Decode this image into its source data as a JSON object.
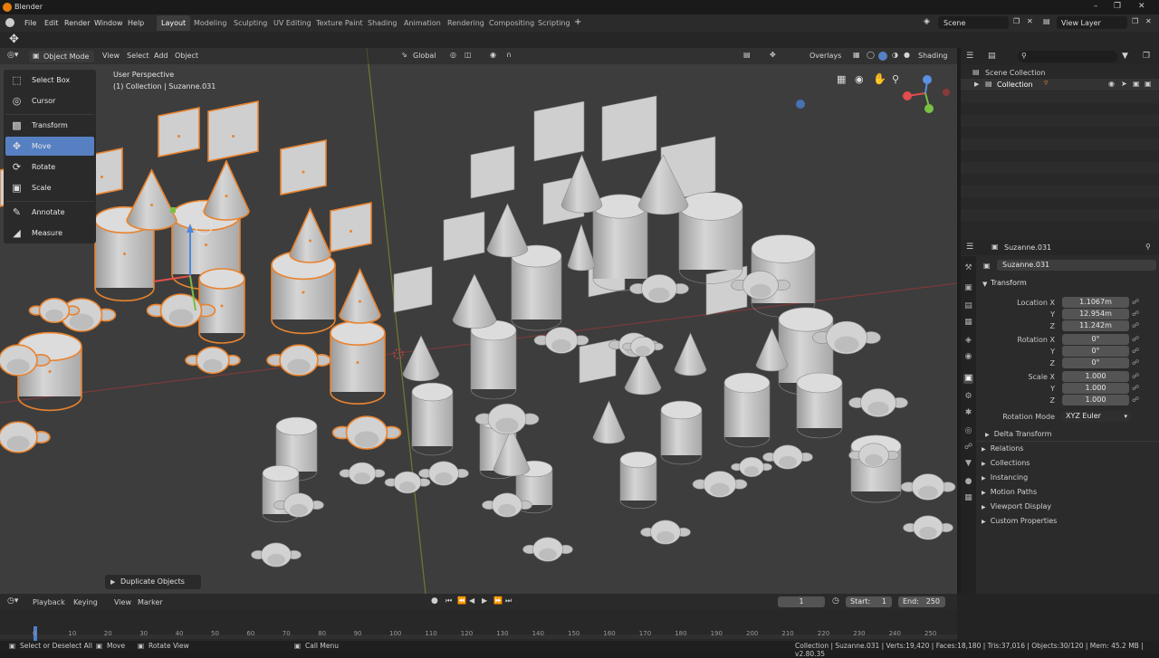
{
  "app": {
    "title": "Blender"
  },
  "menu": [
    "File",
    "Edit",
    "Render",
    "Window",
    "Help"
  ],
  "workspaces": [
    "Layout",
    "Modeling",
    "Sculpting",
    "UV Editing",
    "Texture Paint",
    "Shading",
    "Animation",
    "Rendering",
    "Compositing",
    "Scripting"
  ],
  "scene": {
    "name": "Scene",
    "view_layer": "View Layer"
  },
  "viewport_header": {
    "mode": "Object Mode",
    "menus": [
      "View",
      "Select",
      "Add",
      "Object"
    ],
    "orientation": "Global",
    "overlays": "Overlays",
    "shading": "Shading"
  },
  "viewport_info": {
    "line1": "User Perspective",
    "line2": "(1) Collection | Suzanne.031"
  },
  "toolbar": {
    "tools": [
      "Select Box",
      "Cursor",
      "Transform",
      "Move",
      "Rotate",
      "Scale",
      "Annotate",
      "Measure"
    ],
    "active": "Move"
  },
  "operator_panel": "Duplicate Objects",
  "outliner": {
    "root": "Scene Collection",
    "collection": "Collection"
  },
  "properties": {
    "object_name": "Suzanne.031",
    "object_field": "Suzanne.031",
    "transform_title": "Transform",
    "location": {
      "label": "Location X",
      "y_label": "Y",
      "z_label": "Z",
      "x": "1.1067m",
      "y": "12.954m",
      "z": "11.242m"
    },
    "rotation": {
      "label": "Rotation X",
      "y_label": "Y",
      "z_label": "Z",
      "x": "0°",
      "y": "0°",
      "z": "0°"
    },
    "scale": {
      "label": "Scale X",
      "y_label": "Y",
      "z_label": "Z",
      "x": "1.000",
      "y": "1.000",
      "z": "1.000"
    },
    "rotation_mode": {
      "label": "Rotation Mode",
      "value": "XYZ Euler"
    },
    "panels": [
      "Delta Transform",
      "Relations",
      "Collections",
      "Instancing",
      "Motion Paths",
      "Viewport Display",
      "Custom Properties"
    ]
  },
  "timeline": {
    "menus": [
      "Playback",
      "Keying",
      "View",
      "Marker"
    ],
    "current_frame": "1",
    "start_label": "Start:",
    "start": "1",
    "end_label": "End:",
    "end": "250",
    "ticks": [
      "0",
      "10",
      "20",
      "30",
      "40",
      "50",
      "60",
      "70",
      "80",
      "90",
      "100",
      "110",
      "120",
      "130",
      "140",
      "150",
      "160",
      "170",
      "180",
      "190",
      "200",
      "210",
      "220",
      "230",
      "240",
      "250"
    ]
  },
  "statusbar": {
    "left1": "Select or Deselect All",
    "left2": "Move",
    "left3": "Rotate View",
    "left4": "Call Menu",
    "right": "Collection | Suzanne.031 | Verts:19,420 | Faces:18,180 | Tris:37,016 | Objects:30/120 | Mem: 45.2 MB | v2.80.35"
  },
  "colors": {
    "accent": "#5680c2",
    "selected_outline": "#e8832f",
    "viewport_bg": "#3d3d3d",
    "object_gray": "#c8c8c8"
  }
}
